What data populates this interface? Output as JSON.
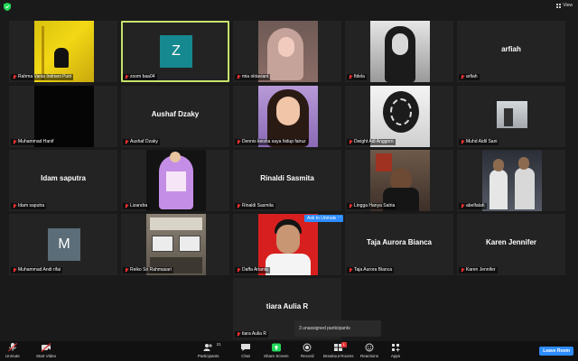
{
  "topbar": {
    "view_label": "View"
  },
  "tiles": [
    {
      "name": "Rahma Vania Indriani Putri"
    },
    {
      "name": "zoom baa04",
      "avatar_letter": "Z",
      "avatar_color": "#16888f"
    },
    {
      "name": "mia oktaviani"
    },
    {
      "name": "fidela"
    },
    {
      "name": "arfiah",
      "display": "arfiah"
    },
    {
      "name": "Muhammad Hanif"
    },
    {
      "name": "Aushaf Dzaky",
      "display": "Aushaf Dzaky"
    },
    {
      "name": "Dennis keisha saya hidup fairuz"
    },
    {
      "name": "Dwight Adi Anggoro"
    },
    {
      "name": "Muhd Aidil Sani"
    },
    {
      "name": "Idam saputra",
      "display": "Idam saputra"
    },
    {
      "name": "Lizandra"
    },
    {
      "name": "Rinaldi Sasmita",
      "display": "Rinaldi Sasmita"
    },
    {
      "name": "Lingga Hanya Satria"
    },
    {
      "name": "abelfatah"
    },
    {
      "name": "Muhammad Andi rifai",
      "avatar_letter": "M",
      "avatar_color": "#5b6d78"
    },
    {
      "name": "Reiko Sri Rahmasari"
    },
    {
      "name": "Daffa Arianta"
    },
    {
      "name": "Taja Aurora Bianca",
      "display": "Taja Aurora Bianca"
    },
    {
      "name": "Karen Jennifer",
      "display": "Karen Jennifer"
    },
    {
      "name": "tiara Aulia R",
      "display": "tiara Aulia R"
    }
  ],
  "ask_to_unmute": "Ask to Unmute",
  "ask_more": "···",
  "unassigned": "3 unassigned participants",
  "toolbar": {
    "unmute": "Unmute",
    "start_video": "Start Video",
    "participants": "Participants",
    "participants_count": "21",
    "chat": "Chat",
    "share_screen": "Share Screen",
    "record": "Record",
    "breakout_rooms": "Breakout Rooms",
    "breakout_badge": "1",
    "reactions": "Reactions",
    "apps": "Apps",
    "leave": "Leave Room"
  },
  "colors": {
    "accent": "#2d8cff",
    "speaking_border": "#c6e46b",
    "share_green": "#23d959",
    "mic_red": "#e33333"
  }
}
